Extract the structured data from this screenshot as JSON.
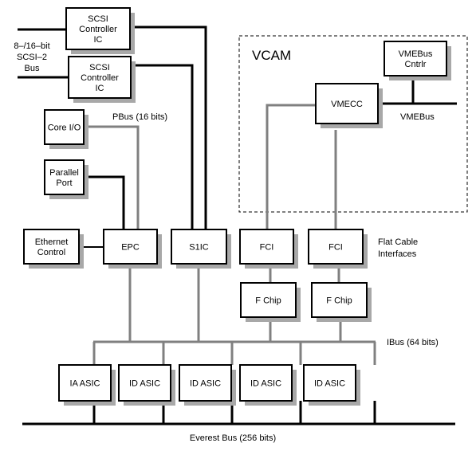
{
  "diagram": {
    "vcam_label": "VCAM",
    "labels": {
      "scsi_bus": [
        "8–/16–bit",
        "SCSI–2",
        "Bus"
      ],
      "pbus": "PBus (16 bits)",
      "vmebus": "VMEBus",
      "flat_cable": [
        "Flat Cable",
        "Interfaces"
      ],
      "ibus": "IBus (64 bits)",
      "everest_bus": "Everest Bus (256 bits)"
    },
    "blocks": {
      "scsi1": [
        "SCSI",
        "Controller",
        "IC"
      ],
      "scsi2": [
        "SCSI",
        "Controller",
        "IC"
      ],
      "core_io": [
        "Core I/O"
      ],
      "parallel_port": [
        "Parallel",
        "Port"
      ],
      "ethernet": [
        "Ethernet",
        "Control"
      ],
      "epc": [
        "EPC"
      ],
      "s1ic": [
        "S1IC"
      ],
      "vmebus_cntrlr": [
        "VMEBus",
        "Cntrlr"
      ],
      "vmecc": [
        "VMECC"
      ],
      "fci1": [
        "FCI"
      ],
      "fci2": [
        "FCI"
      ],
      "fchip1": [
        "F Chip"
      ],
      "fchip2": [
        "F Chip"
      ],
      "asic1": [
        "IA ASIC"
      ],
      "asic2": [
        "ID ASIC"
      ],
      "asic3": [
        "ID ASIC"
      ],
      "asic4": [
        "ID ASIC"
      ],
      "asic5": [
        "ID ASIC"
      ]
    }
  }
}
